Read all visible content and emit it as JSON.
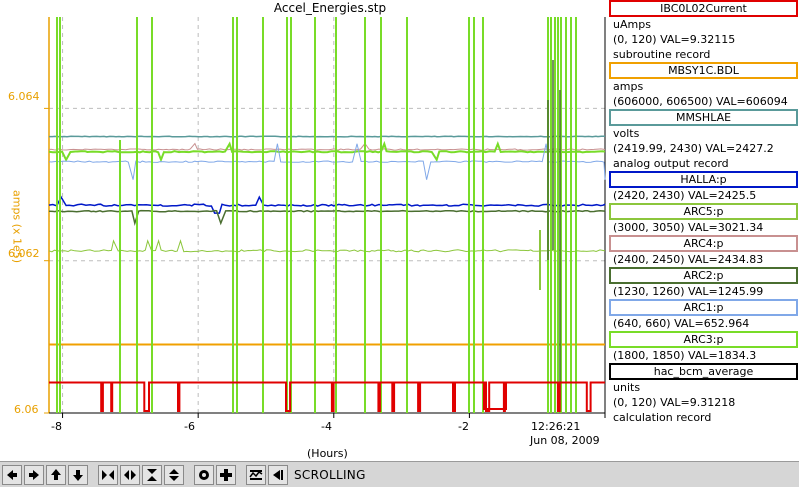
{
  "plot": {
    "title": "Accel_Energies.stp",
    "ylabel": "amps (x 1e5)",
    "xlabel": "(Hours)",
    "y_ticks": [
      "6.064",
      "6.062",
      "6.06"
    ],
    "x_ticks": [
      "-8",
      "-6",
      "-4",
      "-2"
    ],
    "end_time": "12:26:21",
    "end_date": "Jun 08, 2009",
    "axis_color": "#e8a000"
  },
  "chart_data": {
    "type": "line",
    "xlabel": "(Hours)",
    "ylabel": "amps (x 1e5)",
    "xlim": [
      -8.2,
      0.0
    ],
    "ylim": [
      6.06,
      6.0652
    ],
    "series": [
      {
        "name": "IBC0L02Current",
        "color": "#e00000",
        "level": 6.0604
      },
      {
        "name": "MBSY1C.BDL",
        "color": "#f0a000",
        "level": 6.0609
      },
      {
        "name": "MMSHLAE",
        "color": "#5a9a9a",
        "level": 6.06363
      },
      {
        "name": "HALLA:p",
        "color": "#0018c8",
        "level": 6.06273
      },
      {
        "name": "ARC5:p",
        "color": "#8cc63c",
        "level": 6.06213
      },
      {
        "name": "ARC4:p",
        "color": "#c89090",
        "level": 6.06346
      },
      {
        "name": "ARC2:p",
        "color": "#4a6e30",
        "level": 6.06265
      },
      {
        "name": "ARC1:p",
        "color": "#80a8e8",
        "level": 6.0633
      },
      {
        "name": "ARC3:p",
        "color": "#78dc28",
        "level": 6.06343
      }
    ]
  },
  "legend": [
    {
      "name": "IBC0L02Current",
      "color": "#e00000",
      "lines": [
        "uAmps",
        "(0, 120) VAL=9.32115",
        "subroutine record"
      ]
    },
    {
      "name": "MBSY1C.BDL",
      "color": "#f0a000",
      "lines": [
        "amps",
        "(606000, 606500) VAL=606094"
      ]
    },
    {
      "name": "MMSHLAE",
      "color": "#5a9a9a",
      "lines": [
        "volts",
        "(2419.99, 2430) VAL=2427.2",
        "analog output record"
      ]
    },
    {
      "name": "HALLA:p",
      "color": "#0018c8",
      "lines": [
        "(2420, 2430) VAL=2425.5"
      ]
    },
    {
      "name": "ARC5:p",
      "color": "#8cc63c",
      "lines": [
        "(3000, 3050) VAL=3021.34"
      ]
    },
    {
      "name": "ARC4:p",
      "color": "#c89090",
      "lines": [
        "(2400, 2450) VAL=2434.83"
      ]
    },
    {
      "name": "ARC2:p",
      "color": "#4a6e30",
      "lines": [
        "(1230, 1260) VAL=1245.99"
      ]
    },
    {
      "name": "ARC1:p",
      "color": "#80a8e8",
      "lines": [
        "(640, 660) VAL=652.964"
      ]
    },
    {
      "name": "ARC3:p",
      "color": "#78dc28",
      "lines": [
        "(1800, 1850) VAL=1834.3"
      ]
    },
    {
      "name": "hac_bcm_average",
      "color": "#000000",
      "lines": [
        "units",
        "(0, 120) VAL=9.31218",
        "calculation record"
      ]
    }
  ],
  "toolbar": {
    "buttons": [
      "arrow-left-icon",
      "arrow-right-icon",
      "arrow-up-icon",
      "arrow-down-icon",
      "zoom-in-horizontal-icon",
      "zoom-out-horizontal-icon",
      "zoom-in-vertical-icon",
      "zoom-out-vertical-icon",
      "stop-icon",
      "add-icon",
      "autoscale-icon",
      "jump-to-end-icon"
    ],
    "mode_label": "SCROLLING"
  }
}
